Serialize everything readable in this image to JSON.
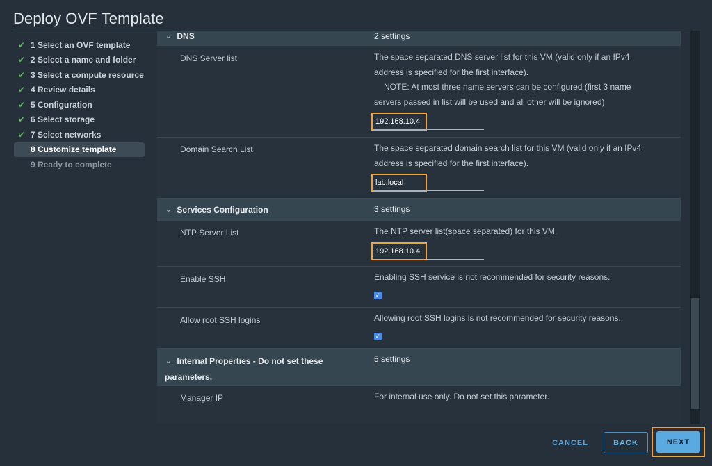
{
  "title": "Deploy OVF Template",
  "steps": [
    {
      "label": "1 Select an OVF template",
      "state": "done"
    },
    {
      "label": "2 Select a name and folder",
      "state": "done"
    },
    {
      "label": "3 Select a compute resource",
      "state": "done"
    },
    {
      "label": "4 Review details",
      "state": "done"
    },
    {
      "label": "5 Configuration",
      "state": "done"
    },
    {
      "label": "6 Select storage",
      "state": "done"
    },
    {
      "label": "7 Select networks",
      "state": "done"
    },
    {
      "label": "8 Customize template",
      "state": "active"
    },
    {
      "label": "9 Ready to complete",
      "state": "pending"
    }
  ],
  "groups": {
    "dns": {
      "label": "DNS",
      "count": "2 settings"
    },
    "services": {
      "label": "Services Configuration",
      "count": "3 settings"
    },
    "internal": {
      "label_line1": "Internal Properties - Do not set these",
      "label_line2": "parameters.",
      "count": "5 settings"
    }
  },
  "props": {
    "dns_server": {
      "name": "DNS Server list",
      "desc1": "The space separated DNS server list for this VM (valid only if an IPv4",
      "desc2": "address is specified for the first interface).",
      "note1": "NOTE: At most three name servers can be configured (first 3 name",
      "note2": "servers passed in list will be used and all other will be ignored)",
      "value": "192.168.10.4"
    },
    "domain_search": {
      "name": "Domain Search List",
      "desc1": "The space separated domain search list for this VM (valid only if an IPv4",
      "desc2": "address is specified for the first interface).",
      "value": "lab.local"
    },
    "ntp": {
      "name": "NTP Server List",
      "desc1": "The NTP server list(space separated) for this VM.",
      "value": "192.168.10.4"
    },
    "ssh": {
      "name": "Enable SSH",
      "desc1": "Enabling SSH service is not recommended for security reasons.",
      "checked": true
    },
    "root_ssh": {
      "name": "Allow root SSH logins",
      "desc1": "Allowing root SSH logins is not recommended for security reasons.",
      "checked": true
    },
    "manager_ip": {
      "name": "Manager IP",
      "desc1": "For internal use only. Do not set this parameter."
    }
  },
  "buttons": {
    "cancel": "CANCEL",
    "back": "BACK",
    "next": "NEXT"
  },
  "icons": {
    "check": "check-icon",
    "chevron": "chevron-down-icon",
    "checkbox": "checkbox-checked-icon"
  },
  "colors": {
    "accent": "#5aa9e0",
    "highlight": "#f0a33a",
    "check": "#5cb85c",
    "background": "#25303a"
  }
}
